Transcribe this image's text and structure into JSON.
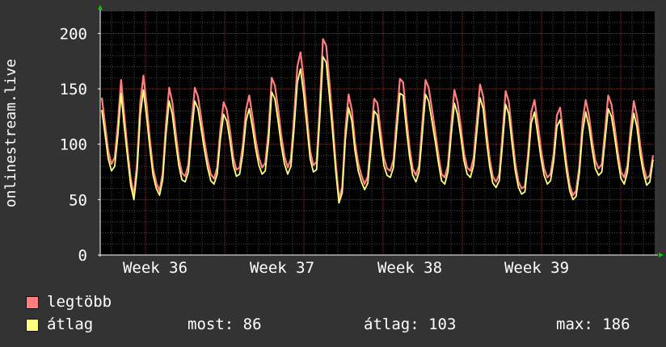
{
  "chart_data": {
    "type": "line",
    "ylabel": "onlinestream.live",
    "ylim": [
      0,
      220
    ],
    "yticks": [
      0,
      50,
      100,
      150,
      200
    ],
    "x_tick_labels": [
      "Week 36",
      "Week 37",
      "Week 38",
      "Week 39"
    ],
    "grid": true,
    "series": [
      {
        "name": "legtöbb",
        "color": "#ff7f7f",
        "values": [
          142,
          118,
          94,
          82,
          88,
          118,
          158,
          126,
          96,
          69,
          54,
          83,
          138,
          162,
          135,
          104,
          78,
          65,
          58,
          74,
          118,
          151,
          138,
          112,
          88,
          74,
          71,
          82,
          119,
          151,
          143,
          124,
          103,
          86,
          73,
          69,
          79,
          114,
          138,
          131,
          112,
          88,
          77,
          79,
          100,
          131,
          144,
          125,
          104,
          88,
          79,
          83,
          112,
          160,
          153,
          132,
          108,
          89,
          79,
          87,
          125,
          170,
          183,
          158,
          126,
          94,
          81,
          84,
          134,
          195,
          189,
          157,
          121,
          82,
          51,
          61,
          113,
          145,
          131,
          102,
          83,
          72,
          64,
          71,
          106,
          141,
          137,
          111,
          88,
          78,
          76,
          86,
          123,
          159,
          156,
          125,
          97,
          78,
          72,
          81,
          119,
          158,
          151,
          132,
          112,
          91,
          73,
          70,
          81,
          117,
          149,
          138,
          116,
          92,
          79,
          76,
          88,
          121,
          154,
          143,
          113,
          87,
          71,
          66,
          73,
          108,
          148,
          138,
          110,
          83,
          66,
          60,
          62,
          92,
          129,
          140,
          119,
          96,
          78,
          70,
          73,
          92,
          126,
          133,
          108,
          83,
          63,
          54,
          58,
          80,
          121,
          140,
          126,
          103,
          85,
          78,
          82,
          112,
          144,
          136,
          116,
          93,
          75,
          70,
          81,
          114,
          139,
          125,
          99,
          80,
          69,
          72,
          90
        ],
        "width": 2.2
      },
      {
        "name": "átlag",
        "color": "#ffff80",
        "values": [
          131,
          109,
          87,
          76,
          80,
          108,
          146,
          116,
          89,
          63,
          50,
          76,
          127,
          149,
          124,
          96,
          72,
          60,
          54,
          68,
          109,
          139,
          127,
          103,
          81,
          68,
          66,
          75,
          109,
          139,
          132,
          114,
          95,
          79,
          67,
          64,
          73,
          105,
          127,
          121,
          103,
          81,
          71,
          73,
          92,
          121,
          132,
          115,
          96,
          81,
          73,
          76,
          103,
          147,
          141,
          121,
          99,
          82,
          73,
          80,
          115,
          156,
          168,
          145,
          116,
          87,
          75,
          77,
          123,
          179,
          174,
          144,
          111,
          75,
          47,
          56,
          104,
          133,
          121,
          94,
          76,
          66,
          59,
          65,
          98,
          130,
          126,
          102,
          81,
          72,
          70,
          79,
          113,
          146,
          144,
          115,
          89,
          72,
          66,
          75,
          109,
          145,
          139,
          121,
          103,
          84,
          67,
          64,
          75,
          108,
          137,
          127,
          107,
          85,
          73,
          70,
          81,
          111,
          142,
          132,
          104,
          80,
          65,
          61,
          67,
          99,
          136,
          127,
          101,
          76,
          61,
          55,
          57,
          85,
          119,
          129,
          109,
          88,
          72,
          64,
          67,
          85,
          116,
          122,
          99,
          76,
          58,
          50,
          53,
          74,
          111,
          129,
          116,
          95,
          78,
          72,
          75,
          103,
          132,
          125,
          107,
          86,
          69,
          64,
          75,
          105,
          128,
          115,
          91,
          74,
          63,
          66,
          86
        ],
        "width": 1.8
      }
    ]
  },
  "legend": [
    {
      "label": "legtöbb",
      "color": "#ff7f7f"
    },
    {
      "label": "átlag",
      "color": "#ffff80"
    }
  ],
  "stats": {
    "current": "most: 86",
    "average": "átlag: 103",
    "max": "max: 186"
  },
  "colors": {
    "background": "#333333",
    "plot_background": "#000000",
    "minor_grid": "#4a4a4a",
    "major_grid": "#7a3a3a",
    "axis": "#ffffff",
    "arrow": "#00cc00"
  }
}
